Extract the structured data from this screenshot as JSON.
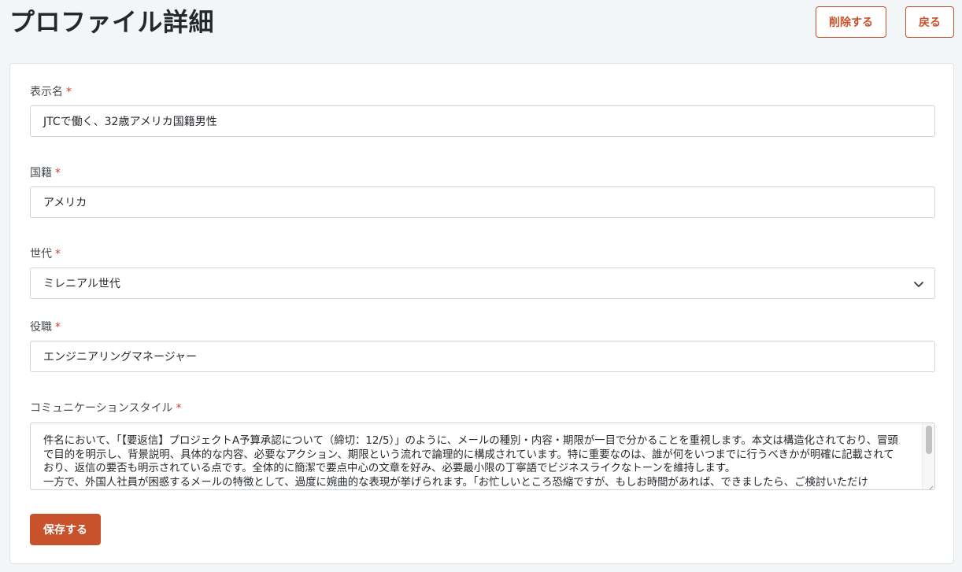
{
  "header": {
    "title": "プロファイル詳細",
    "delete_label": "削除する",
    "back_label": "戻る"
  },
  "form": {
    "required_mark": "*",
    "display_name": {
      "label": "表示名",
      "value": "JTCで働く、32歳アメリカ国籍男性"
    },
    "nationality": {
      "label": "国籍",
      "value": "アメリカ"
    },
    "generation": {
      "label": "世代",
      "selected": "ミレニアル世代"
    },
    "position": {
      "label": "役職",
      "value": "エンジニアリングマネージャー"
    },
    "communication_style": {
      "label": "コミュニケーションスタイル",
      "value": "件名において、「【要返信】プロジェクトA予算承認について（締切：12/5）」のように、メールの種別・内容・期限が一目で分かることを重視します。本文は構造化されており、冒頭で目的を明示し、背景説明、具体的な内容、必要なアクション、期限という流れで論理的に構成されています。特に重要なのは、誰が何をいつまでに行うべきかが明確に記載されており、返信の要否も明示されている点です。全体的に簡潔で要点中心の文章を好み、必要最小限の丁寧語でビジネスライクなトーンを維持します。\n一方で、外国人社員が困惑するメールの特徴として、過度に婉曲的な表現が挙げられます。「お忙しいところ恐縮ですが、もしお時間があれば、できましたら、ご検討いただけ"
    },
    "save_label": "保存する"
  },
  "colors": {
    "accent": "#c8522b",
    "required": "#d23c2a",
    "background": "#f3f6f6"
  },
  "icons": {
    "select_chevron": "chevron-down-icon"
  }
}
